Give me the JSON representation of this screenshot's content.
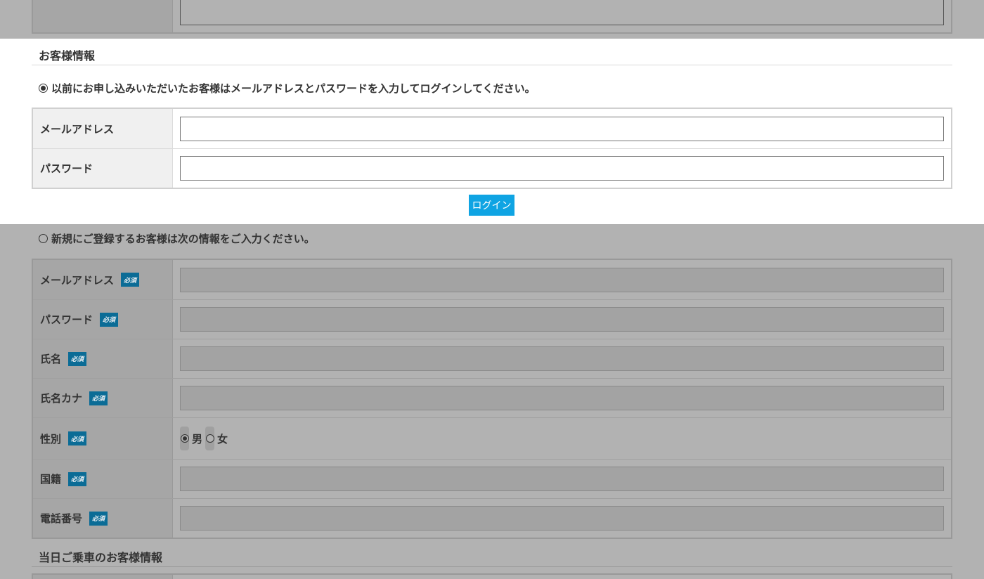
{
  "customer_info": {
    "title": "お客様情報",
    "login_option": "以前にお申し込みいただいたお客様はメールアドレスとパスワードを入力してログインしてください。",
    "fields": [
      {
        "label": "メールアドレス"
      },
      {
        "label": "パスワード"
      }
    ],
    "login_button": "ログイン"
  },
  "registration": {
    "option": "新規にご登録するお客様は次の情報をご入力ください。",
    "required_badge": "必須",
    "fields": {
      "email": "メールアドレス",
      "password": "パスワード",
      "name": "氏名",
      "name_kana": "氏名カナ",
      "gender": "性別",
      "nationality": "国籍",
      "phone": "電話番号"
    },
    "gender_options": [
      "男",
      "女"
    ]
  },
  "passenger_info": {
    "title": "当日ご乗車のお客様情報"
  },
  "colors": {
    "login_button": "#0fa4e3",
    "required_badge": "#0b6c96",
    "overlay": "#b2b2b2"
  }
}
